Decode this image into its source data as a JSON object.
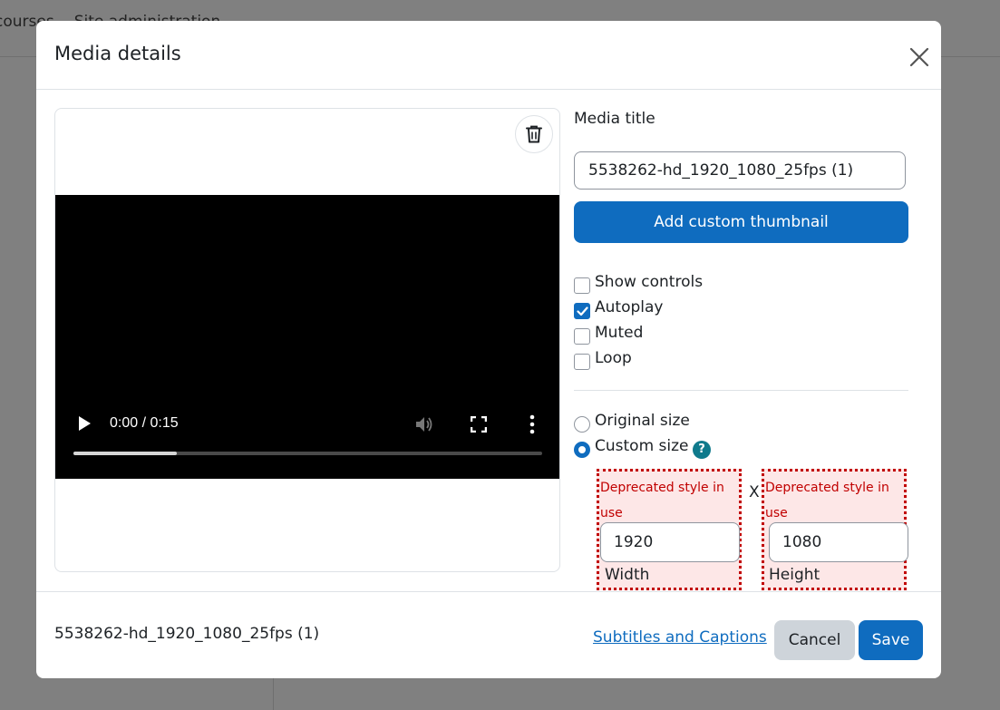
{
  "background": {
    "nav_items": [
      "courses",
      "Site administration"
    ]
  },
  "modal": {
    "title": "Media details",
    "media_title_label": "Media title",
    "media_title_value": "5538262-hd_1920_1080_25fps (1)",
    "add_thumbnail_label": "Add custom thumbnail",
    "checkboxes": [
      {
        "label": "Show controls",
        "checked": false
      },
      {
        "label": "Autoplay",
        "checked": true
      },
      {
        "label": "Muted",
        "checked": false
      },
      {
        "label": "Loop",
        "checked": false
      }
    ],
    "size_options": [
      {
        "label": "Original size",
        "checked": false
      },
      {
        "label": "Custom size",
        "checked": true
      }
    ],
    "help_glyph": "?",
    "deprecated_text": "Deprecated style in use",
    "times_glyph": "X",
    "width_value": "1920",
    "width_label": "Width",
    "height_value": "1080",
    "height_label": "Height",
    "video": {
      "time": "0:00 / 0:15",
      "progress_fraction": 0.22
    },
    "footer": {
      "filename": "5538262-hd_1920_1080_25fps (1)",
      "subtitles_link": "Subtitles and Captions",
      "cancel_label": "Cancel",
      "save_label": "Save"
    }
  },
  "colors": {
    "primary": "#0f6cbf",
    "deprecated": "#c10000",
    "help": "#0f7a8c"
  },
  "icons": [
    "close-icon",
    "trash-icon",
    "play-icon",
    "volume-icon",
    "fullscreen-icon",
    "more-vertical-icon",
    "check-icon",
    "help-icon"
  ]
}
